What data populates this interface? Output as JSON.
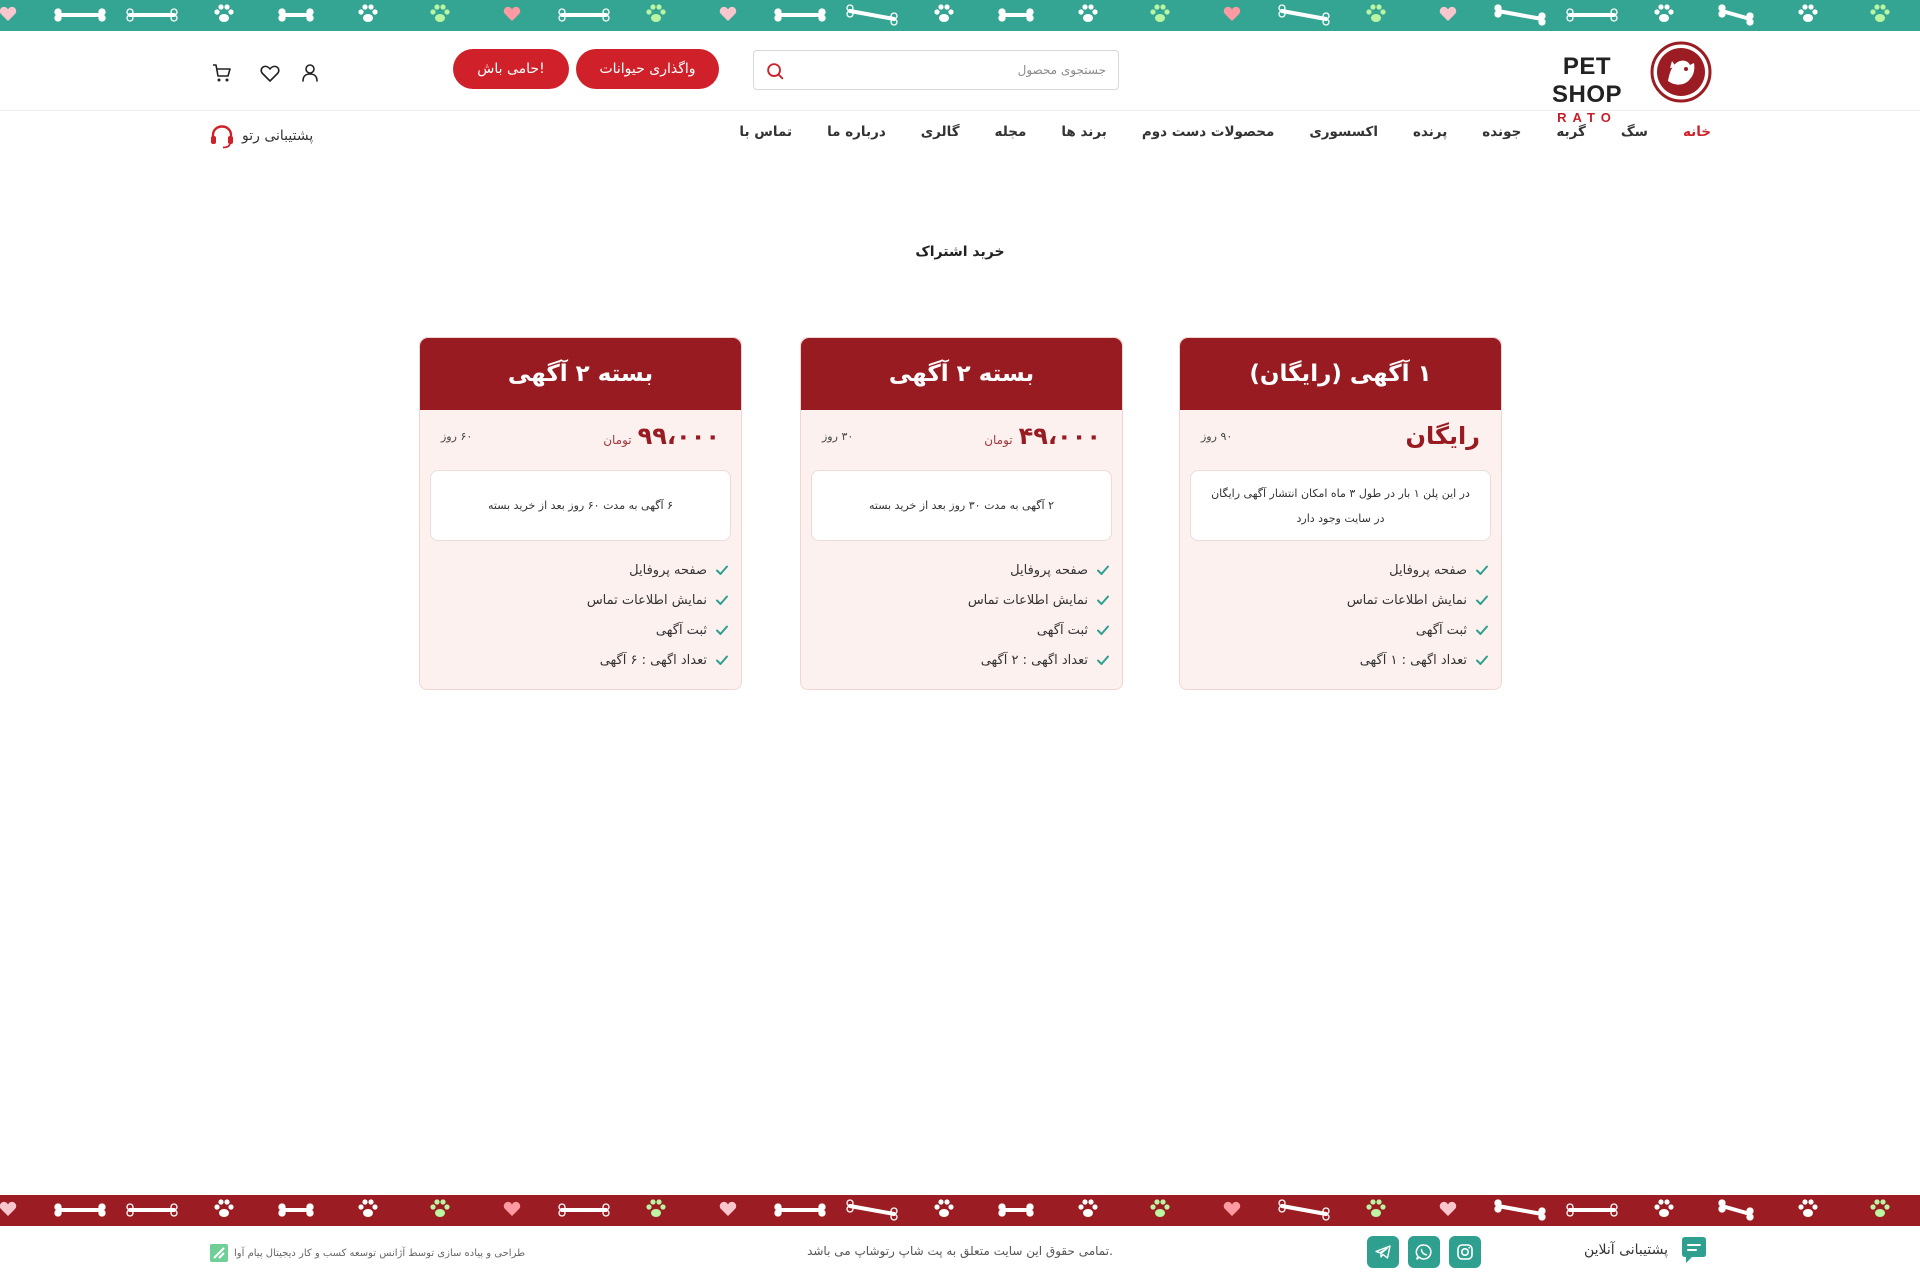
{
  "colors": {
    "accent_red": "#d0202a",
    "plan_header": "#991b22",
    "top_strip": "#34a593",
    "bottom_strip": "#9b1c22",
    "plan_bg": "#fdf1ef",
    "social_green": "#2fa08f"
  },
  "logo": {
    "title": "PET SHOP",
    "subtitle": "RATO"
  },
  "header": {
    "search_placeholder": "جستجوی محصول",
    "adopt_button": "واگذاری حیوانات",
    "sponsor_button": "حامی باش!",
    "icons": [
      "user-icon",
      "heart-icon",
      "cart-icon"
    ]
  },
  "nav": {
    "items": [
      "خانه",
      "سگ",
      "گربه",
      "جونده",
      "پرنده",
      "اکسسوری",
      "محصولات دست دوم",
      "برند ها",
      "مجله",
      "گالری",
      "درباره ما",
      "تماس با"
    ],
    "active_index": 0,
    "support_label": "پشتیبانی رتو"
  },
  "page": {
    "title": "خرید اشتراک"
  },
  "plans": [
    {
      "title": "۱ آگهی (رایگان)",
      "price": "رایگان",
      "currency": "",
      "duration": "۹۰ روز",
      "description": "در این پلن ۱ بار در طول ۳ ماه امکان انتشار آگهی رایگان در سایت وجود دارد",
      "features": [
        "صفحه پروفایل",
        "نمایش اطلاعات تماس",
        "ثبت آگهی",
        "تعداد اگهی : ۱ آگهی"
      ]
    },
    {
      "title": "بسته ۲ آگهی",
      "price": "۴۹،۰۰۰",
      "currency": "تومان",
      "duration": "۳۰ روز",
      "description": "۲ آگهی به مدت ۳۰ روز بعد از خرید بسته",
      "features": [
        "صفحه پروفایل",
        "نمایش اطلاعات تماس",
        "ثبت آگهی",
        "تعداد اگهی : ۲ آگهی"
      ]
    },
    {
      "title": "بسته ۲ آگهی",
      "price": "۹۹،۰۰۰",
      "currency": "تومان",
      "duration": "۶۰ روز",
      "description": "۶ آگهی به مدت ۶۰ روز بعد از خرید بسته",
      "features": [
        "صفحه پروفایل",
        "نمایش اطلاعات تماس",
        "ثبت آگهی",
        "تعداد اگهی : ۶ آگهی"
      ]
    }
  ],
  "footer": {
    "support_label": "پشتیبانی آنلاین",
    "social": [
      "instagram-icon",
      "whatsapp-icon",
      "telegram-icon"
    ],
    "copyright": "تمامی حقوق این سایت متعلق به پت شاپ رتوشاپ می باشد.",
    "designer": "طراحی و پیاده سازی توسط آژانس توسعه کسب و کار دیجیتال پیام آوا"
  }
}
